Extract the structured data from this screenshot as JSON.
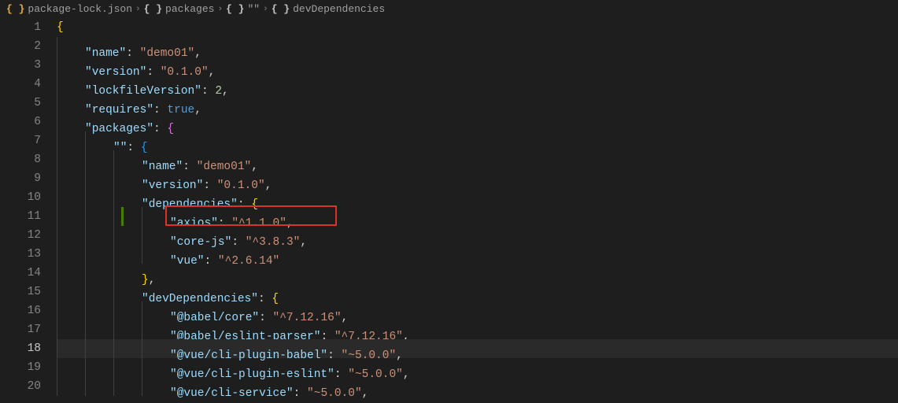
{
  "breadcrumb": {
    "items": [
      {
        "icon": "braces-yellow",
        "label": "package-lock.json"
      },
      {
        "icon": "braces",
        "label": "packages"
      },
      {
        "icon": "braces",
        "label": "\"\""
      },
      {
        "icon": "braces",
        "label": "devDependencies"
      }
    ]
  },
  "active_line": 18,
  "highlight": {
    "line": 11,
    "text": "\"axios\": \"^1.1.0\","
  },
  "code": [
    {
      "n": 1,
      "indent": 0,
      "tokens": [
        {
          "t": "{",
          "c": "brace-yellow"
        }
      ]
    },
    {
      "n": 2,
      "indent": 1,
      "tokens": [
        {
          "t": "\"name\"",
          "c": "key"
        },
        {
          "t": ": ",
          "c": "punct"
        },
        {
          "t": "\"demo01\"",
          "c": "string"
        },
        {
          "t": ",",
          "c": "punct"
        }
      ]
    },
    {
      "n": 3,
      "indent": 1,
      "tokens": [
        {
          "t": "\"version\"",
          "c": "key"
        },
        {
          "t": ": ",
          "c": "punct"
        },
        {
          "t": "\"0.1.0\"",
          "c": "string"
        },
        {
          "t": ",",
          "c": "punct"
        }
      ]
    },
    {
      "n": 4,
      "indent": 1,
      "tokens": [
        {
          "t": "\"lockfileVersion\"",
          "c": "key"
        },
        {
          "t": ": ",
          "c": "punct"
        },
        {
          "t": "2",
          "c": "number"
        },
        {
          "t": ",",
          "c": "punct"
        }
      ]
    },
    {
      "n": 5,
      "indent": 1,
      "tokens": [
        {
          "t": "\"requires\"",
          "c": "key"
        },
        {
          "t": ": ",
          "c": "punct"
        },
        {
          "t": "true",
          "c": "bool"
        },
        {
          "t": ",",
          "c": "punct"
        }
      ]
    },
    {
      "n": 6,
      "indent": 1,
      "tokens": [
        {
          "t": "\"packages\"",
          "c": "key"
        },
        {
          "t": ": ",
          "c": "punct"
        },
        {
          "t": "{",
          "c": "brace-purple"
        }
      ]
    },
    {
      "n": 7,
      "indent": 2,
      "tokens": [
        {
          "t": "\"\"",
          "c": "key"
        },
        {
          "t": ": ",
          "c": "punct"
        },
        {
          "t": "{",
          "c": "brace-blue"
        }
      ]
    },
    {
      "n": 8,
      "indent": 3,
      "tokens": [
        {
          "t": "\"name\"",
          "c": "key"
        },
        {
          "t": ": ",
          "c": "punct"
        },
        {
          "t": "\"demo01\"",
          "c": "string"
        },
        {
          "t": ",",
          "c": "punct"
        }
      ]
    },
    {
      "n": 9,
      "indent": 3,
      "tokens": [
        {
          "t": "\"version\"",
          "c": "key"
        },
        {
          "t": ": ",
          "c": "punct"
        },
        {
          "t": "\"0.1.0\"",
          "c": "string"
        },
        {
          "t": ",",
          "c": "punct"
        }
      ]
    },
    {
      "n": 10,
      "indent": 3,
      "tokens": [
        {
          "t": "\"dependencies\"",
          "c": "key"
        },
        {
          "t": ": ",
          "c": "punct"
        },
        {
          "t": "{",
          "c": "brace-yellow"
        }
      ]
    },
    {
      "n": 11,
      "indent": 4,
      "tokens": [
        {
          "t": "\"axios\"",
          "c": "key"
        },
        {
          "t": ": ",
          "c": "punct"
        },
        {
          "t": "\"^1.1.0\"",
          "c": "string"
        },
        {
          "t": ",",
          "c": "punct"
        }
      ]
    },
    {
      "n": 12,
      "indent": 4,
      "tokens": [
        {
          "t": "\"core-js\"",
          "c": "key"
        },
        {
          "t": ": ",
          "c": "punct"
        },
        {
          "t": "\"^3.8.3\"",
          "c": "string"
        },
        {
          "t": ",",
          "c": "punct"
        }
      ]
    },
    {
      "n": 13,
      "indent": 4,
      "tokens": [
        {
          "t": "\"vue\"",
          "c": "key"
        },
        {
          "t": ": ",
          "c": "punct"
        },
        {
          "t": "\"^2.6.14\"",
          "c": "string"
        }
      ]
    },
    {
      "n": 14,
      "indent": 3,
      "tokens": [
        {
          "t": "}",
          "c": "brace-yellow"
        },
        {
          "t": ",",
          "c": "punct"
        }
      ]
    },
    {
      "n": 15,
      "indent": 3,
      "tokens": [
        {
          "t": "\"devDependencies\"",
          "c": "key"
        },
        {
          "t": ": ",
          "c": "punct"
        },
        {
          "t": "{",
          "c": "brace-yellow"
        }
      ]
    },
    {
      "n": 16,
      "indent": 4,
      "tokens": [
        {
          "t": "\"@babel/core\"",
          "c": "key"
        },
        {
          "t": ": ",
          "c": "punct"
        },
        {
          "t": "\"^7.12.16\"",
          "c": "string"
        },
        {
          "t": ",",
          "c": "punct"
        }
      ]
    },
    {
      "n": 17,
      "indent": 4,
      "tokens": [
        {
          "t": "\"@babel/eslint-parser\"",
          "c": "key"
        },
        {
          "t": ": ",
          "c": "punct"
        },
        {
          "t": "\"^7.12.16\"",
          "c": "string"
        },
        {
          "t": ",",
          "c": "punct"
        }
      ]
    },
    {
      "n": 18,
      "indent": 4,
      "tokens": [
        {
          "t": "\"@vue/cli-plugin-babel\"",
          "c": "key"
        },
        {
          "t": ": ",
          "c": "punct"
        },
        {
          "t": "\"~5.0.0\"",
          "c": "string"
        },
        {
          "t": ",",
          "c": "punct"
        }
      ]
    },
    {
      "n": 19,
      "indent": 4,
      "tokens": [
        {
          "t": "\"@vue/cli-plugin-eslint\"",
          "c": "key"
        },
        {
          "t": ": ",
          "c": "punct"
        },
        {
          "t": "\"~5.0.0\"",
          "c": "string"
        },
        {
          "t": ",",
          "c": "punct"
        }
      ]
    },
    {
      "n": 20,
      "indent": 4,
      "tokens": [
        {
          "t": "\"@vue/cli-service\"",
          "c": "key"
        },
        {
          "t": ": ",
          "c": "punct"
        },
        {
          "t": "\"~5.0.0\"",
          "c": "string"
        },
        {
          "t": ",",
          "c": "punct"
        }
      ]
    }
  ]
}
